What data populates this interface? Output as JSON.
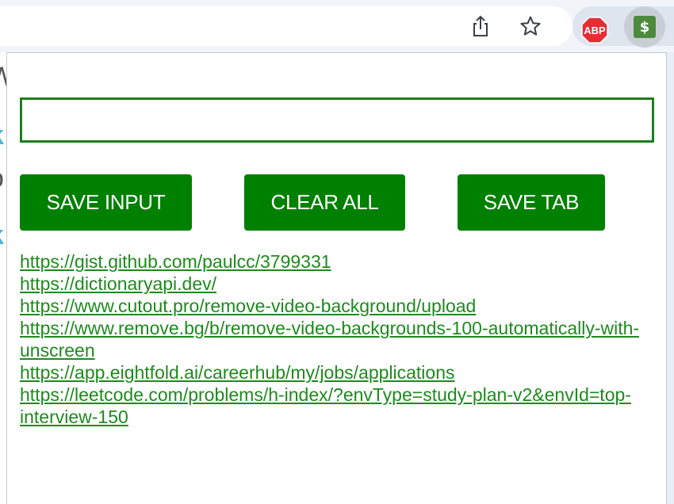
{
  "browser": {
    "share_icon": "share-icon",
    "bookmark_icon": "star-icon",
    "extensions": [
      {
        "name": "abp",
        "label": "ABP",
        "color": "#e52d36"
      },
      {
        "name": "dollar",
        "label": "$",
        "color": "#4e8a3e"
      }
    ]
  },
  "page_behind": {
    "fragments": [
      "W",
      "k",
      "o",
      "k"
    ]
  },
  "popup": {
    "input": {
      "value": "",
      "placeholder": ""
    },
    "buttons": {
      "save_input": "SAVE INPUT",
      "clear_all": "CLEAR ALL",
      "save_tab": "SAVE TAB"
    },
    "links": [
      {
        "text": "https://gist.github.com/paulcc/3799331"
      },
      {
        "text": "https://dictionaryapi.dev/"
      },
      {
        "text": "https://www.cutout.pro/remove-video-background/upload"
      },
      {
        "text": "https://www.remove.bg/b/remove-video-backgrounds-100-automatically-with-unscreen"
      },
      {
        "text": "https://app.eightfold.ai/careerhub/my/jobs/applications"
      },
      {
        "text": "https://leetcode.com/problems/h-index/?envType=study-plan-v2&envId=top-interview-150"
      }
    ]
  },
  "colors": {
    "accent": "#008000",
    "link": "#1e8a1e",
    "input_border": "#1e7d1e"
  }
}
